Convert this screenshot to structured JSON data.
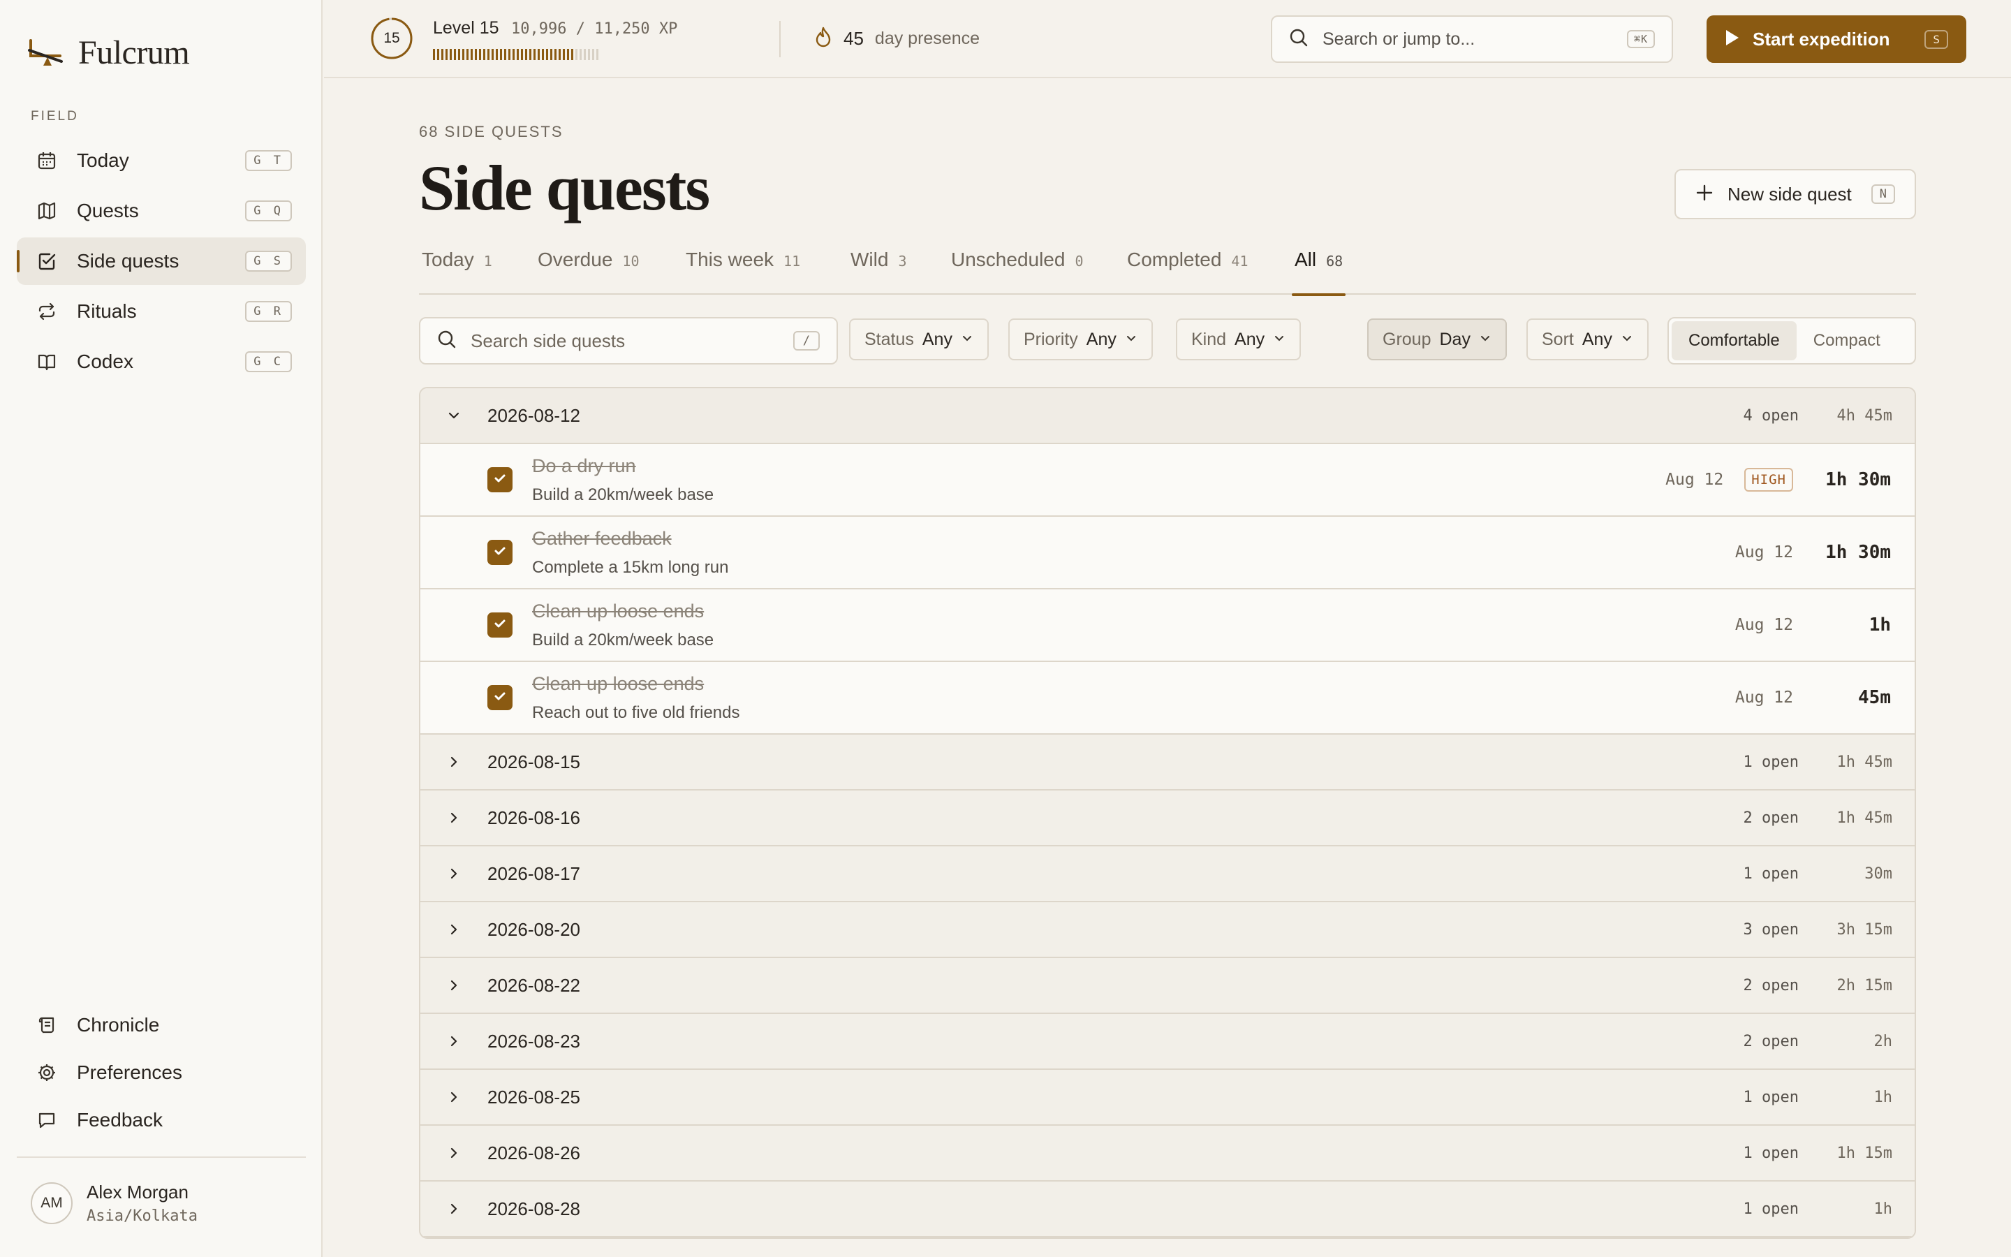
{
  "app": {
    "name": "Fulcrum"
  },
  "sidebar": {
    "section_label": "FIELD",
    "items": [
      {
        "label": "Today",
        "shortcut": "G T",
        "icon": "calendar-icon"
      },
      {
        "label": "Quests",
        "shortcut": "G Q",
        "icon": "map-icon"
      },
      {
        "label": "Side quests",
        "shortcut": "G S",
        "icon": "check-square-icon",
        "active": true
      },
      {
        "label": "Rituals",
        "shortcut": "G R",
        "icon": "repeat-icon"
      },
      {
        "label": "Codex",
        "shortcut": "G C",
        "icon": "book-icon"
      }
    ],
    "bottom_items": [
      {
        "label": "Chronicle",
        "icon": "scroll-icon"
      },
      {
        "label": "Preferences",
        "icon": "gear-icon"
      },
      {
        "label": "Feedback",
        "icon": "message-icon"
      }
    ],
    "user": {
      "initials": "AM",
      "name": "Alex Morgan",
      "timezone": "Asia/Kolkata"
    }
  },
  "topbar": {
    "level_number": "15",
    "level_label": "Level 15",
    "xp_text": "10,996 / 11,250 XP",
    "xp_progress": 0.977,
    "streak_count": "45",
    "streak_label": "day presence",
    "search_placeholder": "Search or jump to...",
    "search_shortcut": "⌘K",
    "start_label": "Start expedition",
    "start_shortcut": "S",
    "accent": "#8a5a12"
  },
  "page": {
    "count_label": "68 SIDE QUESTS",
    "title": "Side quests",
    "new_label": "New side quest",
    "new_shortcut": "N"
  },
  "tabs": [
    {
      "label": "Today",
      "count": "1"
    },
    {
      "label": "Overdue",
      "count": "10"
    },
    {
      "label": "This week",
      "count": "11"
    },
    {
      "label": "Wild",
      "count": "3"
    },
    {
      "label": "Unscheduled",
      "count": "0"
    },
    {
      "label": "Completed",
      "count": "41"
    },
    {
      "label": "All",
      "count": "68",
      "active": true
    }
  ],
  "filters": {
    "search_placeholder": "Search side quests",
    "search_shortcut": "/",
    "status": {
      "key": "Status",
      "value": "Any"
    },
    "priority": {
      "key": "Priority",
      "value": "Any"
    },
    "kind": {
      "key": "Kind",
      "value": "Any"
    },
    "group": {
      "key": "Group",
      "value": "Day"
    },
    "sort": {
      "key": "Sort",
      "value": "Any"
    },
    "density": [
      "Comfortable",
      "Compact"
    ]
  },
  "groups": [
    {
      "date": "2026-08-12",
      "open": "4 open",
      "duration": "4h 45m",
      "expanded": true,
      "items": [
        {
          "title": "Do a dry run",
          "subtitle": "Build a 20km/week base",
          "when": "Aug 12",
          "priority": "HIGH",
          "duration": "1h 30m"
        },
        {
          "title": "Gather feedback",
          "subtitle": "Complete a 15km long run",
          "when": "Aug 12",
          "priority": "",
          "duration": "1h 30m"
        },
        {
          "title": "Clean up loose ends",
          "subtitle": "Build a 20km/week base",
          "when": "Aug 12",
          "priority": "",
          "duration": "1h"
        },
        {
          "title": "Clean up loose ends",
          "subtitle": "Reach out to five old friends",
          "when": "Aug 12",
          "priority": "",
          "duration": "45m"
        }
      ]
    },
    {
      "date": "2026-08-15",
      "open": "1 open",
      "duration": "1h 45m"
    },
    {
      "date": "2026-08-16",
      "open": "2 open",
      "duration": "1h 45m"
    },
    {
      "date": "2026-08-17",
      "open": "1 open",
      "duration": "30m"
    },
    {
      "date": "2026-08-20",
      "open": "3 open",
      "duration": "3h 15m"
    },
    {
      "date": "2026-08-22",
      "open": "2 open",
      "duration": "2h 15m"
    },
    {
      "date": "2026-08-23",
      "open": "2 open",
      "duration": "2h"
    },
    {
      "date": "2026-08-25",
      "open": "1 open",
      "duration": "1h"
    },
    {
      "date": "2026-08-26",
      "open": "1 open",
      "duration": "1h 15m"
    },
    {
      "date": "2026-08-28",
      "open": "1 open",
      "duration": "1h"
    }
  ]
}
